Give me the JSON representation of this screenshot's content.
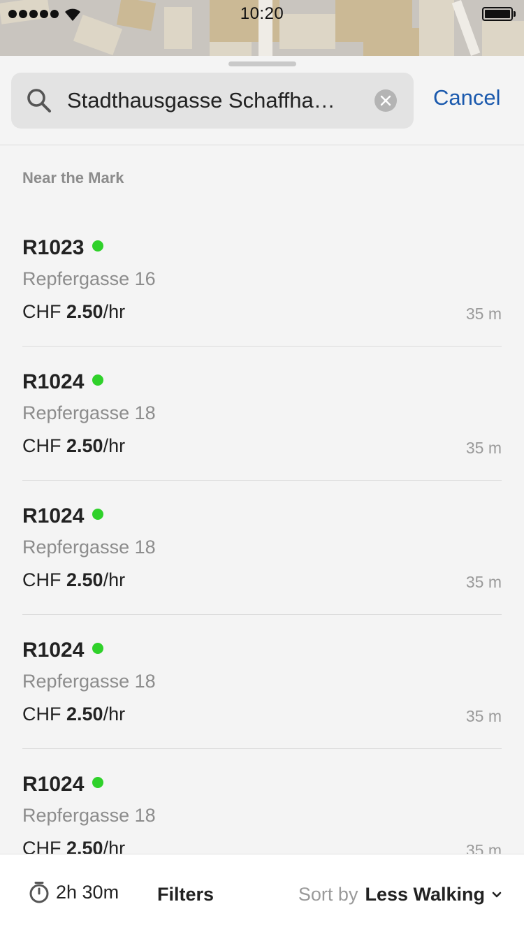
{
  "status_bar": {
    "time": "10:20"
  },
  "search": {
    "query": "Stadthausgasse Schaffha…",
    "cancel_label": "Cancel"
  },
  "section": {
    "label": "Near the Mark"
  },
  "results": [
    {
      "code": "R1023",
      "address": "Repfergasse 16",
      "currency": "CHF",
      "rate": "2.50",
      "unit": "/hr",
      "distance": "35 m",
      "available": true
    },
    {
      "code": "R1024",
      "address": "Repfergasse 18",
      "currency": "CHF",
      "rate": "2.50",
      "unit": "/hr",
      "distance": "35 m",
      "available": true
    },
    {
      "code": "R1024",
      "address": "Repfergasse 18",
      "currency": "CHF",
      "rate": "2.50",
      "unit": "/hr",
      "distance": "35 m",
      "available": true
    },
    {
      "code": "R1024",
      "address": "Repfergasse 18",
      "currency": "CHF",
      "rate": "2.50",
      "unit": "/hr",
      "distance": "35 m",
      "available": true
    },
    {
      "code": "R1024",
      "address": "Repfergasse 18",
      "currency": "CHF",
      "rate": "2.50",
      "unit": "/hr",
      "distance": "35 m",
      "available": true
    }
  ],
  "bottom_bar": {
    "duration": "2h 30m",
    "filters_label": "Filters",
    "sort_label": "Sort by",
    "sort_value": "Less Walking"
  },
  "colors": {
    "accent": "#1a59ad",
    "available_dot": "#2fd12a"
  },
  "icons": {
    "search": "search-icon",
    "clear": "clear-icon",
    "timer": "stopwatch-icon",
    "sort": "chevron-down-icon"
  }
}
